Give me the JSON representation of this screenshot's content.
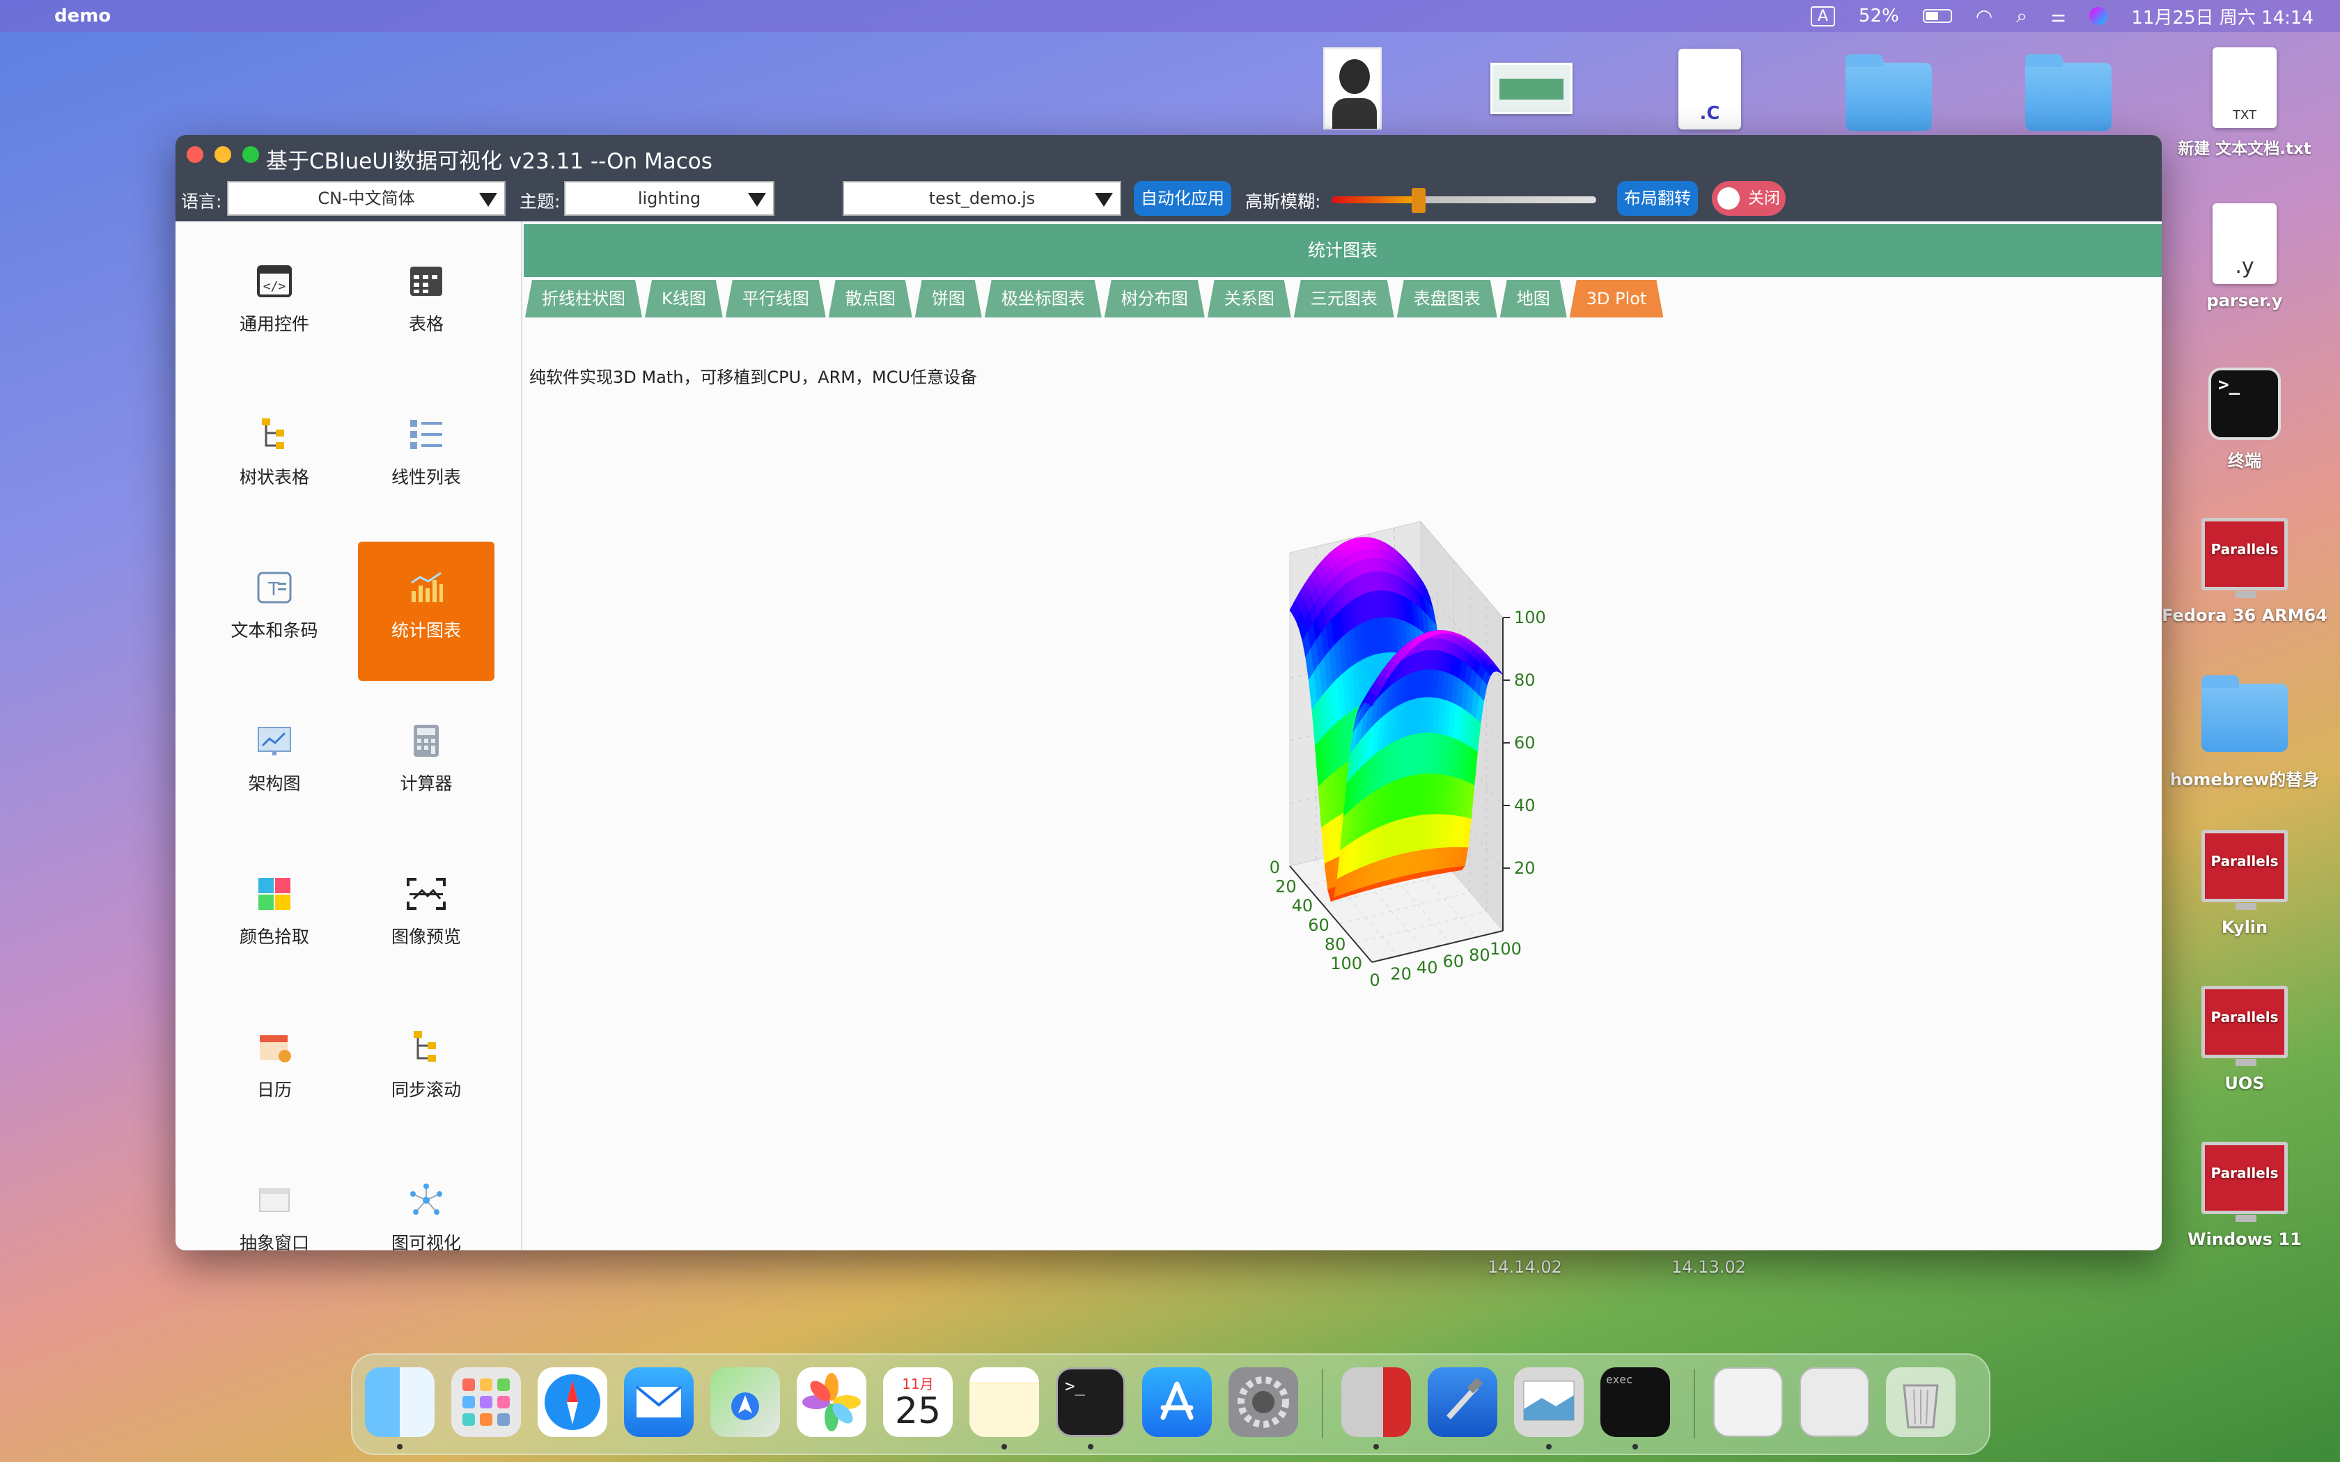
{
  "menubar": {
    "app_name": "demo",
    "input_source": "A",
    "battery": "52%",
    "datetime": "11月25日 周六  14:14"
  },
  "desktop": {
    "items": [
      {
        "label": "新建 文本文档.txt",
        "kind": "TXT"
      },
      {
        "label": "parser.y",
        "kind": ".y"
      },
      {
        "label": "终端",
        "kind": ">_"
      },
      {
        "label": "Fedora 36 ARM64",
        "kind": "Parallels"
      },
      {
        "label": "homebrew的替身",
        "kind": "folder"
      },
      {
        "label": "Kylin",
        "kind": "Parallels"
      },
      {
        "label": "UOS",
        "kind": "Parallels"
      },
      {
        "label": "Windows 11",
        "kind": "Parallels"
      }
    ],
    "top_file_c": ".C",
    "screenshot_labels": [
      "14.14.02",
      "14.13.02"
    ]
  },
  "window": {
    "title": "基于CBlueUI数据可视化 v23.11 --On Macos",
    "language_label": "语言:",
    "language_value": "CN-中文简体",
    "theme_label": "主题:",
    "theme_value": "lighting",
    "script_value": "test_demo.js",
    "auto_button": "自动化应用",
    "blur_label": "高斯模糊:",
    "blur_level": 0.33,
    "layout_button": "布局翻转",
    "close_toggle": "关闭"
  },
  "sidebar": {
    "items": [
      {
        "label": "通用控件",
        "icon": "code-icon"
      },
      {
        "label": "表格",
        "icon": "table-icon"
      },
      {
        "label": "树状表格",
        "icon": "tree-icon"
      },
      {
        "label": "线性列表",
        "icon": "list-icon"
      },
      {
        "label": "文本和条码",
        "icon": "text-icon"
      },
      {
        "label": "统计图表",
        "icon": "chart-icon",
        "active": true
      },
      {
        "label": "架构图",
        "icon": "diagram-icon"
      },
      {
        "label": "计算器",
        "icon": "calculator-icon"
      },
      {
        "label": "颜色拾取",
        "icon": "color-icon"
      },
      {
        "label": "图像预览",
        "icon": "image-icon"
      },
      {
        "label": "日历",
        "icon": "calendar-icon"
      },
      {
        "label": "同步滚动",
        "icon": "sync-icon"
      },
      {
        "label": "抽象窗口",
        "icon": "window-icon"
      },
      {
        "label": "图可视化",
        "icon": "graph-icon"
      }
    ]
  },
  "main": {
    "header": "统计图表",
    "tabs": [
      "折线柱状图",
      "K线图",
      "平行线图",
      "散点图",
      "饼图",
      "极坐标图表",
      "树分布图",
      "关系图",
      "三元图表",
      "表盘图表",
      "地图",
      "3D Plot"
    ],
    "active_tab": "3D Plot",
    "caption": "纯软件实现3D Math，可移植到CPU，ARM，MCU任意设备"
  },
  "chart_data": {
    "type": "surface3d",
    "x_ticks": [
      "0",
      "20",
      "40",
      "60",
      "80",
      "100"
    ],
    "y_ticks": [
      "0",
      "20",
      "40",
      "60",
      "80",
      "100"
    ],
    "z_ticks": [
      "20",
      "40",
      "60",
      "80",
      "100"
    ],
    "xlim": [
      0,
      100
    ],
    "ylim": [
      0,
      100
    ],
    "zlim": [
      0,
      100
    ],
    "colormap": [
      "#ff0000",
      "#ffff00",
      "#00ff00",
      "#00ffff",
      "#0000ff",
      "#ff00ff"
    ],
    "grid": true
  },
  "dock": {
    "calendar_month": "11月",
    "calendar_day": "25",
    "exec_label": "exec"
  }
}
